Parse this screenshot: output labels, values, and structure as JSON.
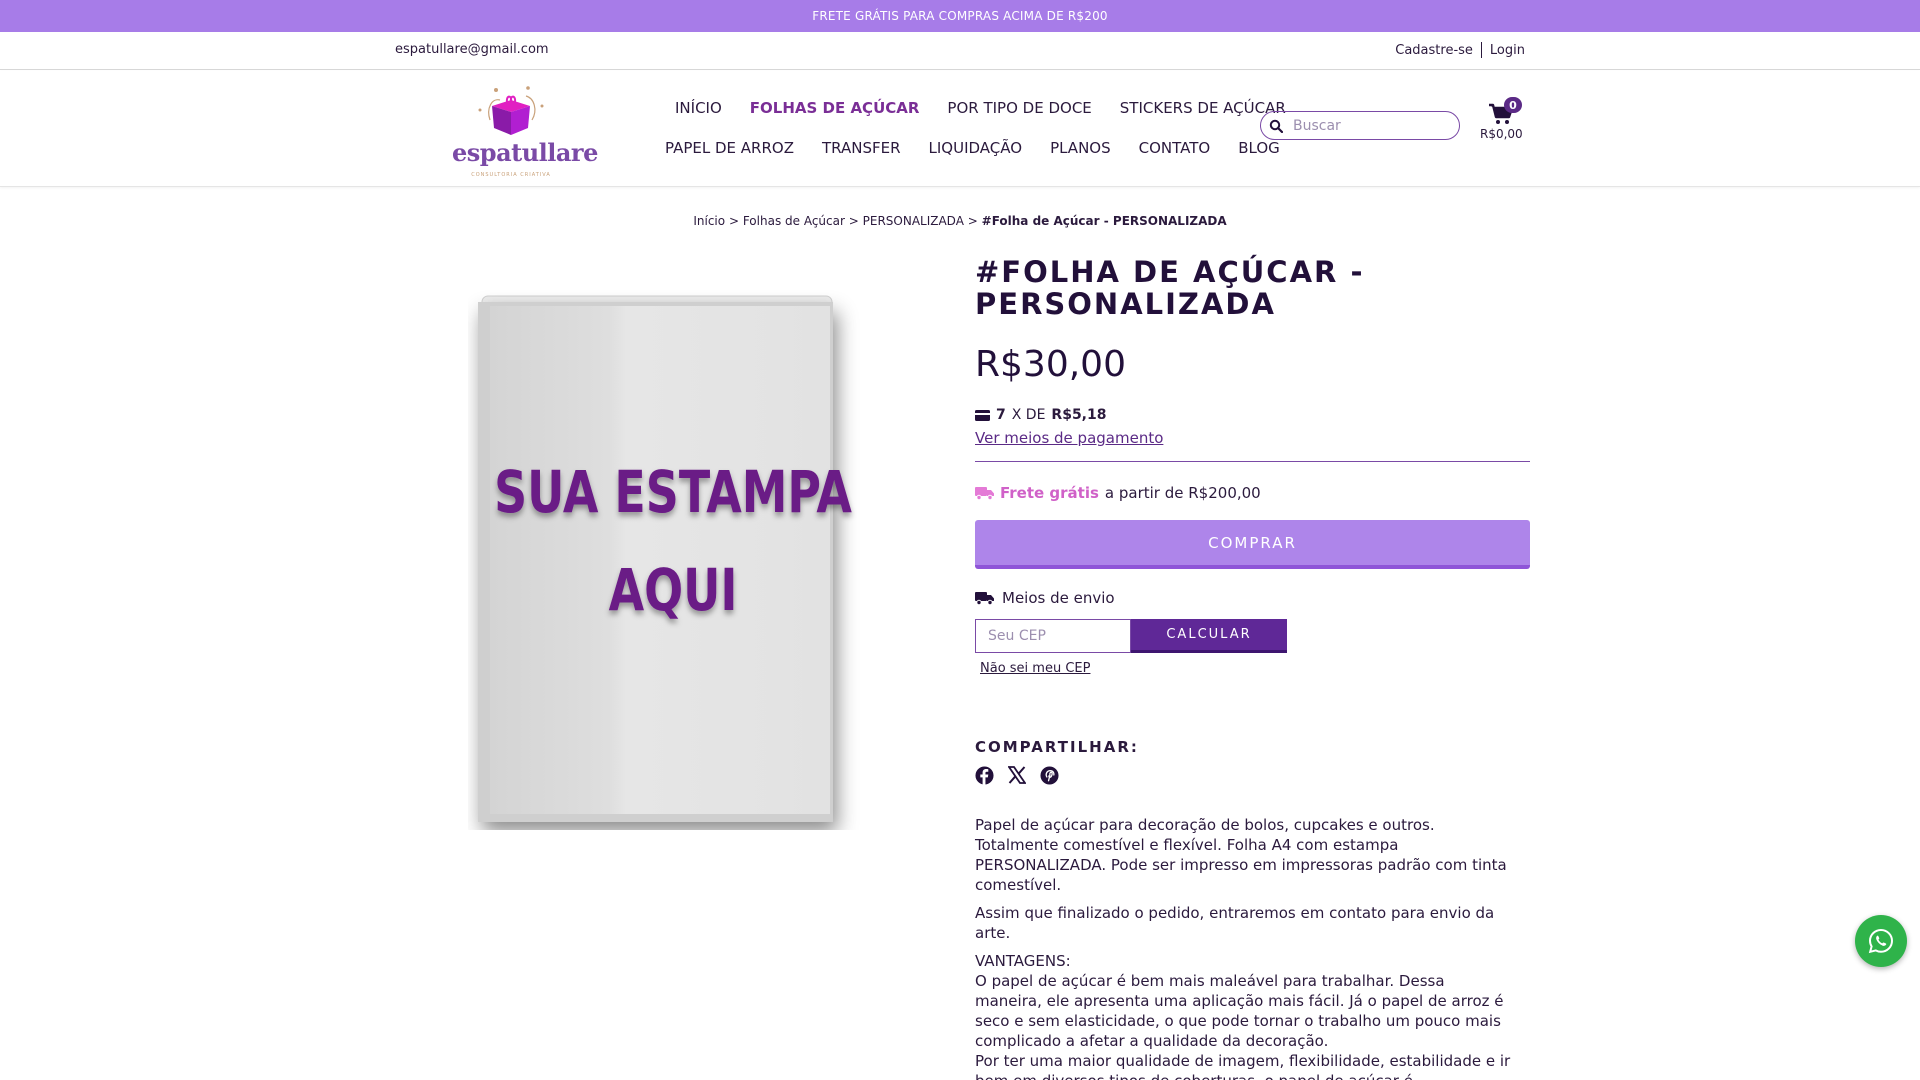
{
  "promo": {
    "text": "FRETE GRÁTIS PARA COMPRAS ACIMA DE R$200"
  },
  "util": {
    "email": "espatullare@gmail.com",
    "register": "Cadastre-se",
    "login": "Login"
  },
  "logo": {
    "name": "espatullare",
    "tagline": "CONSULTORIA CRIATIVA"
  },
  "nav": {
    "row1": [
      "INÍCIO",
      "FOLHAS DE AÇÚCAR",
      "POR TIPO DE DOCE",
      "STICKERS DE AÇÚCAR"
    ],
    "row2": [
      "PAPEL DE ARROZ",
      "TRANSFER",
      "LIQUIDAÇÃO",
      "PLANOS",
      "CONTATO",
      "BLOG"
    ],
    "active": "FOLHAS DE AÇÚCAR"
  },
  "search": {
    "placeholder": "Buscar"
  },
  "cart": {
    "count": "0",
    "total": "R$0,00"
  },
  "breadcrumb": {
    "items": [
      "Início",
      "Folhas de Açúcar",
      "PERSONALIZADA"
    ],
    "current": "#Folha de Açúcar - PERSONALIZADA",
    "separator": ">"
  },
  "product": {
    "image_text_line1": "SUA ESTAMPA",
    "image_text_line2": "AQUI",
    "title": "#Folha de Açúcar - PERSONALIZADA",
    "price": "R$30,00",
    "installments_count": "7",
    "installments_x": "X DE",
    "installments_value": "R$5,18",
    "payment_link": "Ver meios de pagamento",
    "free_shipping_label": "Frete grátis",
    "free_shipping_rest": "a partir de R$200,00",
    "buy_label": "COMPRAR",
    "shipping_methods_label": "Meios de envio",
    "cep_placeholder": "Seu CEP",
    "calculate_label": "CALCULAR",
    "cep_unknown_link": "Não sei meu CEP"
  },
  "share": {
    "title": "COMPARTILHAR:"
  },
  "description": {
    "p1": "Papel de açúcar para decoração de bolos, cupcakes e outros. Totalmente comestível e flexível. Folha A4 com estampa PERSONALIZADA. Pode ser impresso em impressoras padrão com tinta comestível.",
    "p2": "Assim que finalizado o pedido, entraremos em contato para envio da arte.",
    "p3_title": "VANTAGENS:",
    "p3_line1": "O papel de açúcar é bem mais maleável para trabalhar. Dessa maneira, ele apresenta uma aplicação mais fácil. Já o papel de arroz é seco e sem elasticidade, o que pode tornar o trabalho um pouco mais complicado a afetar a qualidade da decoração.",
    "p3_line2": "Por ter uma maior qualidade de imagem, flexibilidade, estabilidade e ir bem em diversos tipos de coberturas, o papel de açúcar é extremamente versátil."
  },
  "colors": {
    "promo": "#a77ce8",
    "brand": "#5b2a86",
    "accent_pink": "#d061c8",
    "buy": "#ae85ea",
    "whatsapp": "#2fb34a"
  }
}
